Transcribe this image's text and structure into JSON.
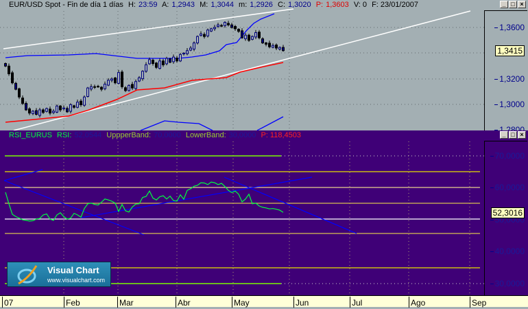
{
  "price_panel": {
    "symbol": "EUR/USD Spot - Fin de día 1 días",
    "h_label": "H:",
    "h_val": "23:59",
    "a_label": "A:",
    "a_val": "1,2943",
    "m_label": "M:",
    "m_val": "1,3044",
    "ml_label": "m:",
    "ml_val": "1,2926",
    "c_label": "C:",
    "c_val": "1,3020",
    "p_label": "P:",
    "p_val": "1,3603",
    "v_label": "V: 0",
    "f_label": "F: 23/01/2007",
    "ticks": [
      "1,3600",
      "1,3200",
      "1,3000",
      "1,2800"
    ],
    "last_value": "1,3415"
  },
  "rsi_panel": {
    "name": "RSI_EURUS",
    "rsi_label": "RSI:",
    "rsi_val": "52,0544",
    "upper_label": "UppperBand:",
    "upper_val": "70,0000",
    "lower_label": "LowerBand:",
    "lower_val": "30,0000",
    "p_label": "P: 118,4503",
    "ticks": [
      "70,0000",
      "60,0000",
      "50,0000",
      "40,0000",
      "30,0000"
    ],
    "last_value": "52,3016"
  },
  "window_buttons": {
    "minimize": "_",
    "maximize": "□",
    "close": "×"
  },
  "x_axis": [
    "07",
    "Feb",
    "Mar",
    "Abr",
    "May",
    "Jun",
    "Jul",
    "Ago",
    "Sep"
  ],
  "logo": {
    "name": "Visual Chart",
    "url": "www.visualchart.com"
  },
  "colors": {
    "price_bg": "#a3afb3",
    "rsi_bg": "#3f0077",
    "rsi_line": "#00ff40",
    "ma_red": "#ff0000",
    "band_blue": "#0000ff",
    "up_candle": "#a3afb3",
    "down_candle": "#000000"
  },
  "chart_data": [
    {
      "type": "candlestick",
      "title": "EUR/USD Spot",
      "ylim": [
        1.28,
        1.37
      ],
      "closes": [
        1.33,
        1.324,
        1.317,
        1.312,
        1.306,
        1.301,
        1.296,
        1.2935,
        1.295,
        1.2925,
        1.296,
        1.294,
        1.297,
        1.2935,
        1.295,
        1.299,
        1.296,
        1.2975,
        1.2945,
        1.3,
        1.298,
        1.302,
        1.3,
        1.306,
        1.313,
        1.314,
        1.3135,
        1.314,
        1.312,
        1.316,
        1.319,
        1.32,
        1.317,
        1.325,
        1.314,
        1.311,
        1.315,
        1.313,
        1.318,
        1.321,
        1.326,
        1.331,
        1.335,
        1.332,
        1.329,
        1.334,
        1.331,
        1.336,
        1.333,
        1.337,
        1.334,
        1.339,
        1.34,
        1.342,
        1.344,
        1.348,
        1.353,
        1.355,
        1.353,
        1.358,
        1.359,
        1.36,
        1.362,
        1.361,
        1.364,
        1.362,
        1.36,
        1.359,
        1.357,
        1.352,
        1.354,
        1.35,
        1.353,
        1.356,
        1.352,
        1.348,
        1.347,
        1.345,
        1.346,
        1.344,
        1.3445,
        1.342
      ]
    },
    {
      "type": "line",
      "title": "RSI_EURUS",
      "ylim": [
        25,
        75
      ],
      "bands": [
        70,
        30
      ],
      "values": [
        58.6,
        55,
        51.7,
        51,
        50.5,
        50,
        49.8,
        49.6,
        49.7,
        50.2,
        50.4,
        51.5,
        51.8,
        50.2,
        49.8,
        51.5,
        52.2,
        51,
        50.2,
        50.5,
        52,
        51.5,
        50.8,
        53.5,
        55.0,
        55.2,
        54.8,
        54.6,
        55.5,
        56.5,
        56.2,
        55.8,
        55.2,
        52.6,
        54.8,
        52.8,
        52.4,
        54.0,
        54.9,
        55.0,
        57.0,
        57.3,
        59.0,
        56.8,
        56.2,
        57.2,
        57.5,
        56.5,
        57.4,
        56.0,
        55.8,
        57.8,
        56.4,
        59.2,
        59.7,
        60.5,
        60.8,
        61.6,
        61.5,
        61.0,
        61.8,
        61.6,
        61.0,
        61.4,
        60.4,
        59.2,
        58.5,
        59.0,
        58.0,
        55.6,
        56.5,
        58.0,
        55.0,
        55.2,
        54.3,
        53.9,
        53.7,
        53.4,
        53.5,
        53.3,
        53.0,
        52.3
      ]
    }
  ]
}
